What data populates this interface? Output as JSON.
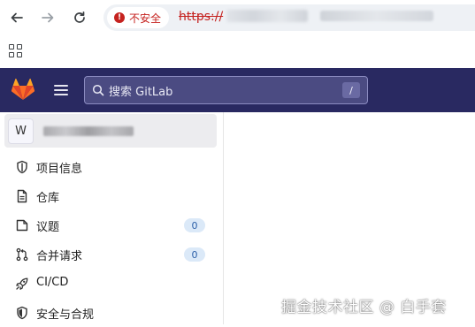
{
  "browser": {
    "security_label": "不安全",
    "url_scheme": "https://",
    "icons": {
      "back": "back-arrow-icon",
      "forward": "forward-arrow-icon",
      "reload": "reload-icon",
      "apps": "apps-grid-icon"
    }
  },
  "header": {
    "search_placeholder": "搜索 GitLab",
    "search_shortcut": "/",
    "colors": {
      "bar": "#292961",
      "search_bg": "#4b4b82"
    }
  },
  "sidebar": {
    "project_avatar": "W",
    "items": [
      {
        "label": "项目信息",
        "icon": "info-shield-icon"
      },
      {
        "label": "仓库",
        "icon": "document-icon"
      },
      {
        "label": "议题",
        "icon": "issues-icon",
        "badge": "0"
      },
      {
        "label": "合并请求",
        "icon": "merge-request-icon",
        "badge": "0"
      },
      {
        "label": "CI/CD",
        "icon": "rocket-icon"
      },
      {
        "label": "安全与合规",
        "icon": "shield-icon"
      }
    ]
  },
  "watermark": "掘金技术社区 @ 白手套"
}
